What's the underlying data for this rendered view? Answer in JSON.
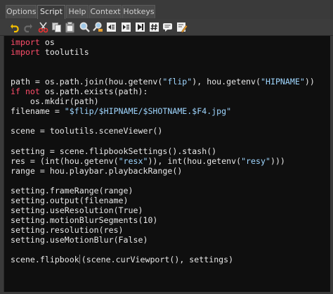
{
  "tabs": [
    {
      "label": "Options",
      "active": false
    },
    {
      "label": "Script",
      "active": true
    },
    {
      "label": "Help",
      "active": false
    },
    {
      "label": "Context",
      "active": false
    },
    {
      "label": "Hotkeys",
      "active": false
    }
  ],
  "toolbar": {
    "buttons": [
      {
        "name": "undo-icon"
      },
      {
        "name": "redo-icon"
      },
      {
        "name": "cut-icon"
      },
      {
        "name": "copy-icon"
      },
      {
        "name": "paste-icon"
      },
      {
        "name": "find-icon"
      },
      {
        "name": "replace-icon"
      },
      {
        "name": "unindent-icon"
      },
      {
        "name": "indent-icon"
      },
      {
        "name": "comment-icon"
      },
      {
        "name": "uncomment-icon"
      },
      {
        "name": "hash-icon"
      },
      {
        "name": "comment-bubble-icon"
      },
      {
        "name": "uncomment-bubble-icon"
      },
      {
        "name": "edit-icon"
      }
    ]
  },
  "colors": {
    "keyword": "#ff4d6a",
    "string": "#9fd6ff",
    "text": "#e8e8e8",
    "editor_bg": "#0f0f0f"
  },
  "code": {
    "lines": [
      [
        {
          "t": "import",
          "c": "kw"
        },
        {
          "t": " os",
          "c": ""
        }
      ],
      [
        {
          "t": "import",
          "c": "kw"
        },
        {
          "t": " toolutils",
          "c": ""
        }
      ],
      [],
      [],
      [
        {
          "t": "path = os.path.join(hou.getenv(",
          "c": ""
        },
        {
          "t": "\"flip\"",
          "c": "str"
        },
        {
          "t": "), hou.getenv(",
          "c": ""
        },
        {
          "t": "\"HIPNAME\"",
          "c": "str"
        },
        {
          "t": "))",
          "c": ""
        }
      ],
      [
        {
          "t": "if",
          "c": "kw"
        },
        {
          "t": " ",
          "c": ""
        },
        {
          "t": "not",
          "c": "kw"
        },
        {
          "t": " os.path.exists(path):",
          "c": ""
        }
      ],
      [
        {
          "t": "    os.mkdir(path)",
          "c": ""
        }
      ],
      [
        {
          "t": "filename = ",
          "c": ""
        },
        {
          "t": "\"$flip/$HIPNAME/$SHOTNAME.$F4.jpg\"",
          "c": "str"
        }
      ],
      [],
      [
        {
          "t": "scene = toolutils.sceneViewer()",
          "c": ""
        }
      ],
      [],
      [
        {
          "t": "setting = scene.flipbookSettings().stash()",
          "c": ""
        }
      ],
      [
        {
          "t": "res = (int(hou.getenv(",
          "c": ""
        },
        {
          "t": "\"resx\"",
          "c": "str"
        },
        {
          "t": ")), int(hou.getenv(",
          "c": ""
        },
        {
          "t": "\"resy\"",
          "c": "str"
        },
        {
          "t": ")))",
          "c": ""
        }
      ],
      [
        {
          "t": "range = hou.playbar.playbackRange()",
          "c": ""
        }
      ],
      [],
      [
        {
          "t": "setting.frameRange(range)",
          "c": ""
        }
      ],
      [
        {
          "t": "setting.output(filename)",
          "c": ""
        }
      ],
      [
        {
          "t": "setting.useResolution(True)",
          "c": ""
        }
      ],
      [
        {
          "t": "setting.motionBlurSegments(10)",
          "c": ""
        }
      ],
      [
        {
          "t": "setting.resolution(res)",
          "c": ""
        }
      ],
      [
        {
          "t": "setting.useMotionBlur(False)",
          "c": ""
        }
      ],
      [],
      [
        {
          "t": "scene.flipbook",
          "c": ""
        },
        {
          "t": "(scene.curViewport(), settings)",
          "c": "cursor"
        }
      ]
    ]
  }
}
